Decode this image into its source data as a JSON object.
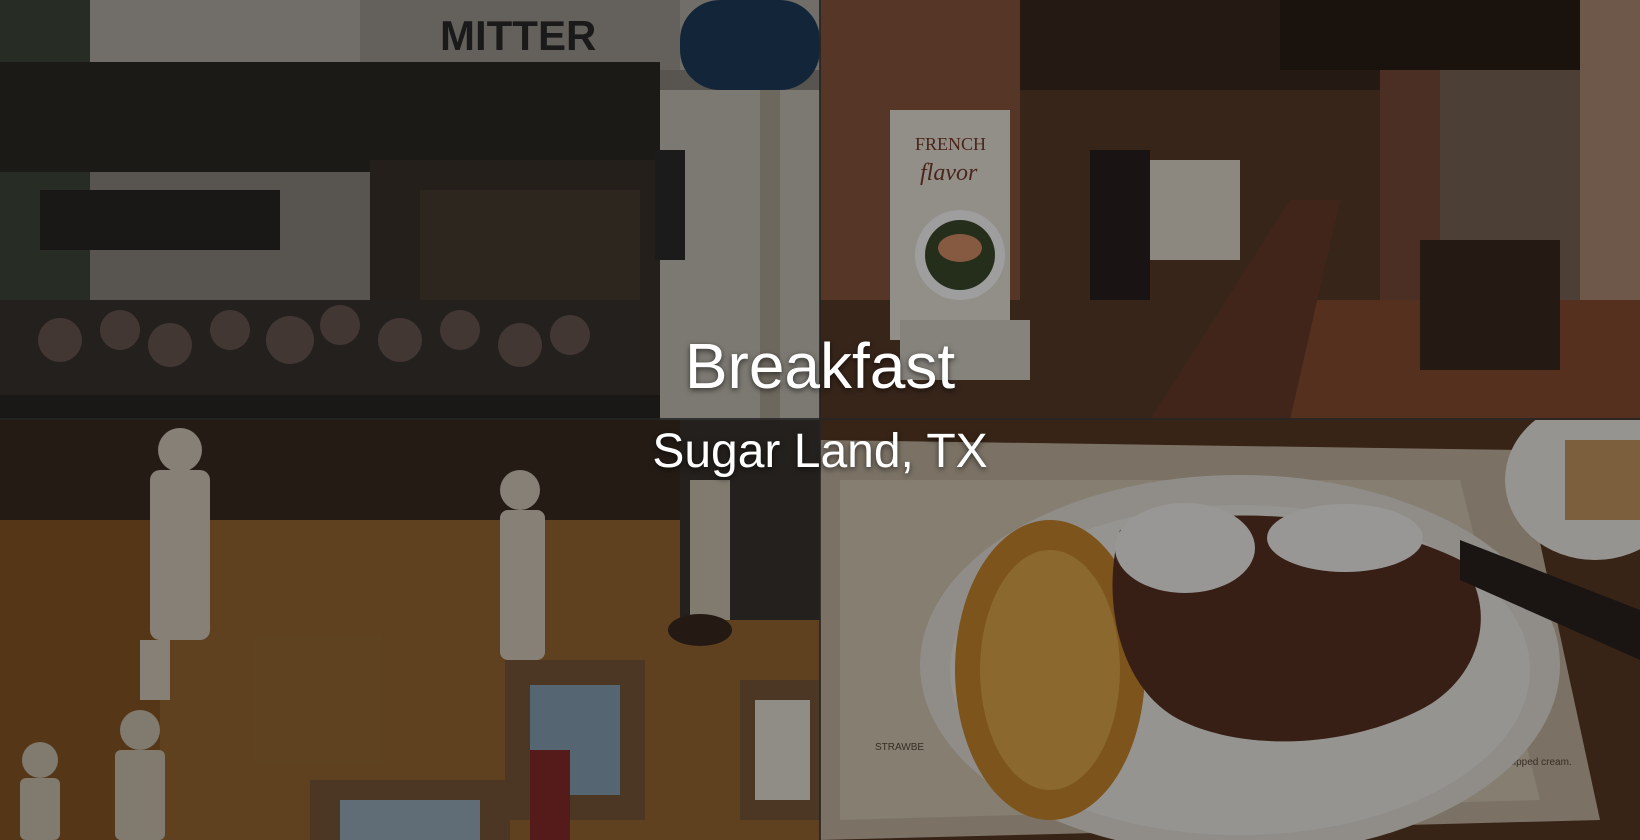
{
  "overlay": {
    "title": "Breakfast",
    "subtitle": "Sugar Land, TX"
  },
  "photos": {
    "storefront": {
      "sign_text": "MITTER"
    },
    "interior": {
      "poster_line1": "FRENCH",
      "poster_line2": "flavor"
    },
    "decor": {},
    "plate": {
      "placemat_text": "STRAWBE",
      "placemat_text2": "th whipped cream."
    }
  },
  "colors": {
    "text": "#ffffff",
    "shade": "rgba(0,0,0,0.38)"
  }
}
